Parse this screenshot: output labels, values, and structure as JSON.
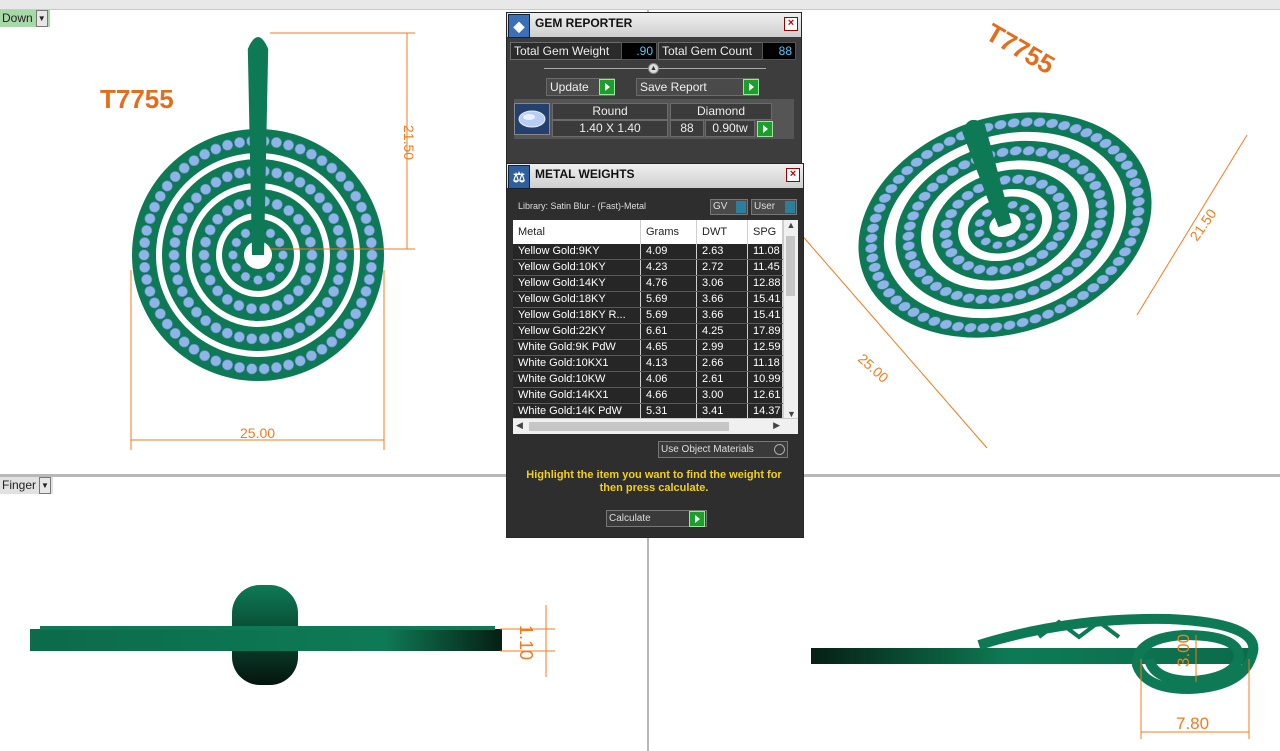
{
  "viewports": {
    "top_left": {
      "label": "Down",
      "title": "T7755",
      "dims": {
        "width": "25.00",
        "height": "21.50"
      }
    },
    "top_right": {
      "title": "T7755",
      "dims": {
        "a": "25.00",
        "b": "21.50"
      }
    },
    "bottom_left": {
      "label": "Finger",
      "dims": {
        "thickness": "1.10"
      }
    },
    "bottom_right": {
      "dims": {
        "height": "3.00",
        "width": "7.80"
      }
    }
  },
  "gem_reporter": {
    "title": "GEM REPORTER",
    "total_weight_label": "Total Gem Weight",
    "total_weight_value": ".90",
    "total_count_label": "Total Gem Count",
    "total_count_value": "88",
    "update_label": "Update",
    "save_label": "Save Report",
    "gem": {
      "shape": "Round",
      "type": "Diamond",
      "size": "1.40 X 1.40",
      "count": "88",
      "weight": "0.90tw"
    }
  },
  "metal_weights": {
    "title": "METAL WEIGHTS",
    "library": "Library: Satin Blur - (Fast)-Metal",
    "gv_label": "GV",
    "user_label": "User",
    "columns": [
      "Metal",
      "Grams",
      "DWT",
      "SPG"
    ],
    "rows": [
      [
        "Yellow Gold:9KY",
        "4.09",
        "2.63",
        "11.08"
      ],
      [
        "Yellow Gold:10KY",
        "4.23",
        "2.72",
        "11.45"
      ],
      [
        "Yellow Gold:14KY",
        "4.76",
        "3.06",
        "12.88"
      ],
      [
        "Yellow Gold:18KY",
        "5.69",
        "3.66",
        "15.41"
      ],
      [
        "Yellow Gold:18KY R...",
        "5.69",
        "3.66",
        "15.41"
      ],
      [
        "Yellow Gold:22KY",
        "6.61",
        "4.25",
        "17.89"
      ],
      [
        "White Gold:9K PdW",
        "4.65",
        "2.99",
        "12.59"
      ],
      [
        "White Gold:10KX1",
        "4.13",
        "2.66",
        "11.18"
      ],
      [
        "White Gold:10KW",
        "4.06",
        "2.61",
        "10.99"
      ],
      [
        "White Gold:14KX1",
        "4.66",
        "3.00",
        "12.61"
      ],
      [
        "White Gold:14K PdW",
        "5.31",
        "3.41",
        "14.37"
      ]
    ],
    "use_object_materials": "Use Object Materials",
    "hint": "Highlight the item you want to find the weight for then press calculate.",
    "calculate_label": "Calculate"
  },
  "colors": {
    "metal_green": "#0e7a55",
    "gem_blue": "#8fb4e6",
    "dim_orange": "#f37b1d",
    "panel_dark": "#2e2e2e",
    "hint_yellow": "#f2cf1d"
  }
}
